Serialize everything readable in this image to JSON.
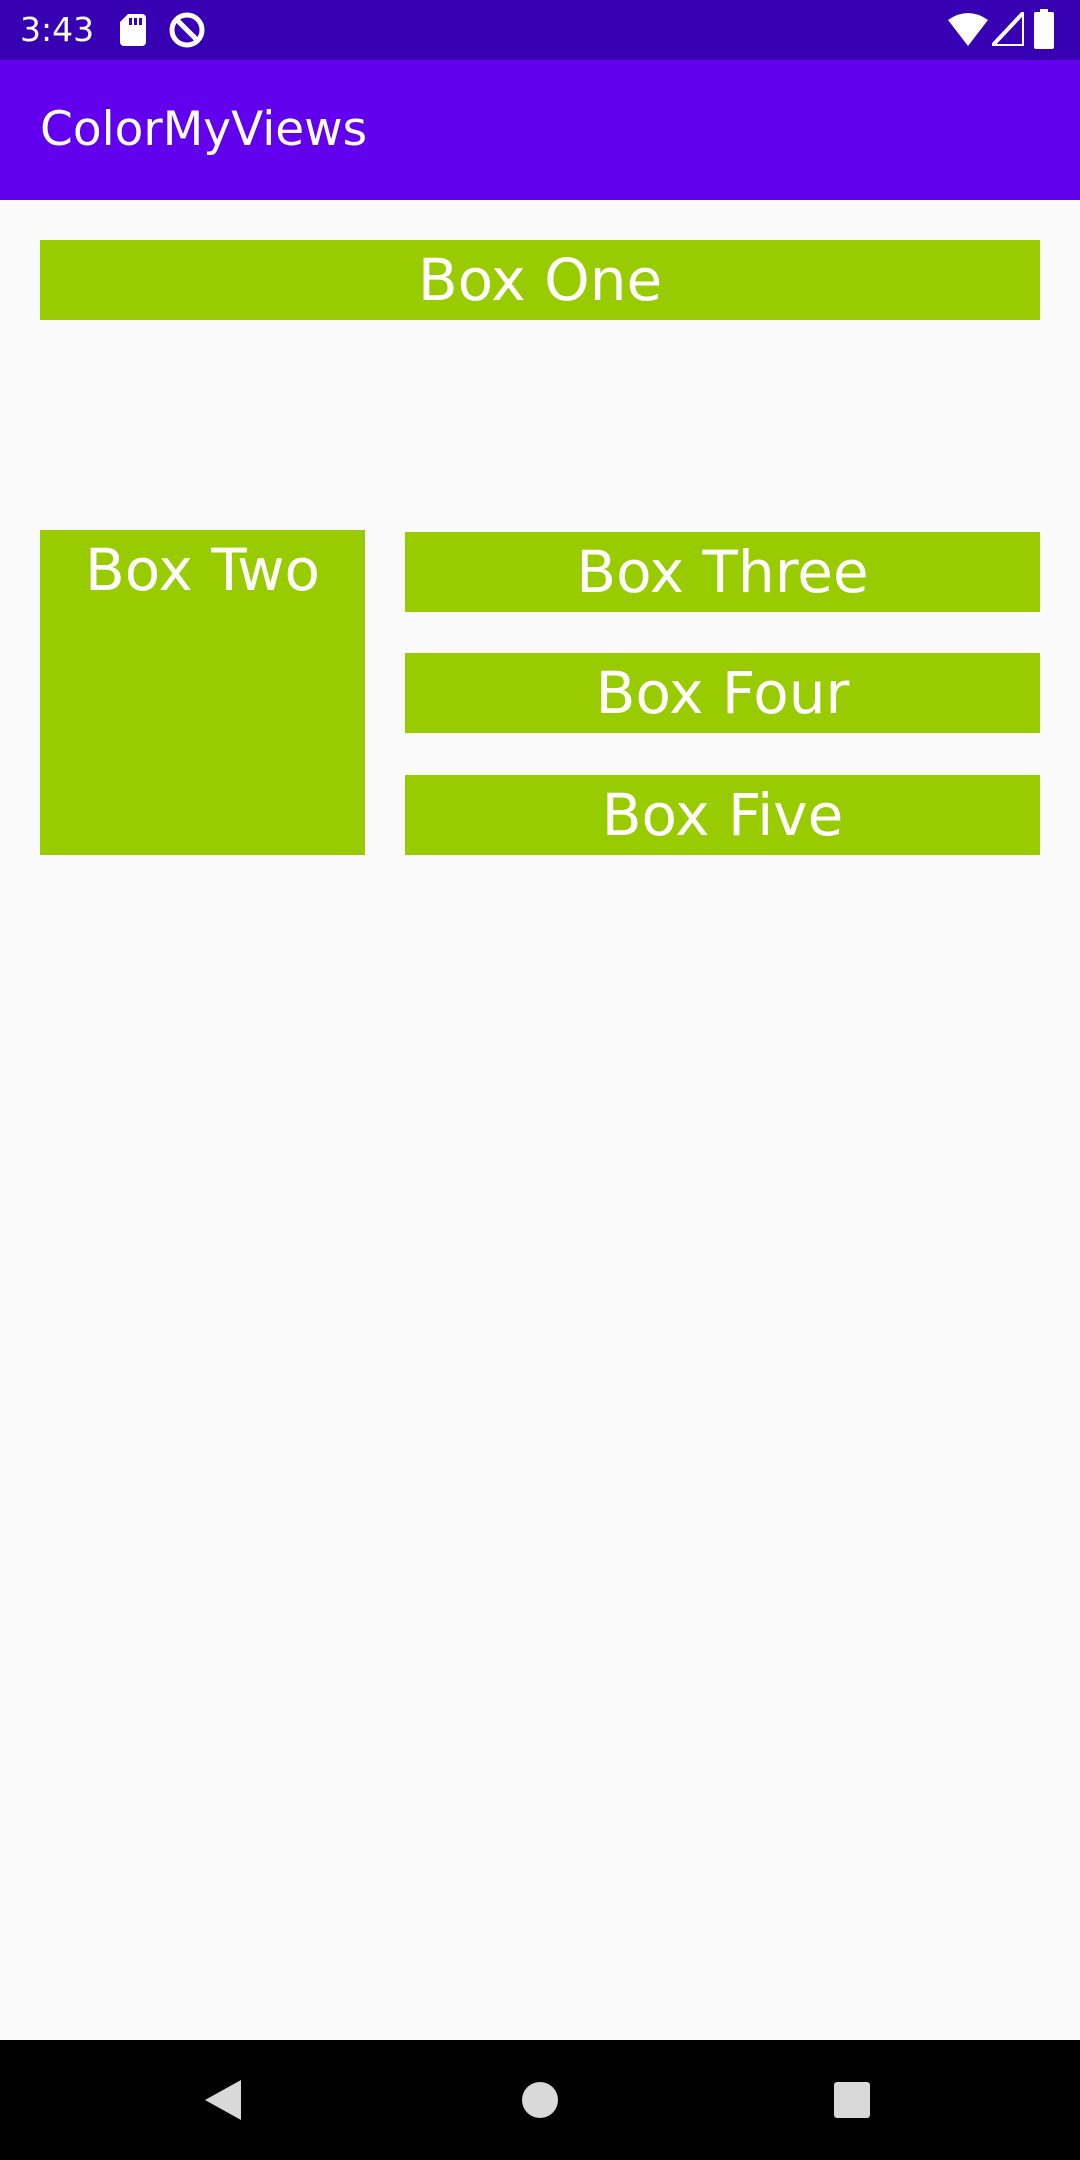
{
  "status_bar": {
    "time": "3:43",
    "icons": [
      "sd-card-icon",
      "do-not-disturb-icon",
      "wifi-icon",
      "cell-signal-icon",
      "battery-icon"
    ],
    "background": "#3700B3"
  },
  "app_bar": {
    "title": "ColorMyViews",
    "background": "#6200EE"
  },
  "boxes": {
    "color": "#99CC00",
    "text_color": "#FFFFFF",
    "box_one": "Box One",
    "box_two": "Box Two",
    "box_three": "Box Three",
    "box_four": "Box Four",
    "box_five": "Box Five"
  },
  "nav_bar": {
    "buttons": [
      "back-icon",
      "home-icon",
      "recents-icon"
    ],
    "background": "#000000"
  }
}
